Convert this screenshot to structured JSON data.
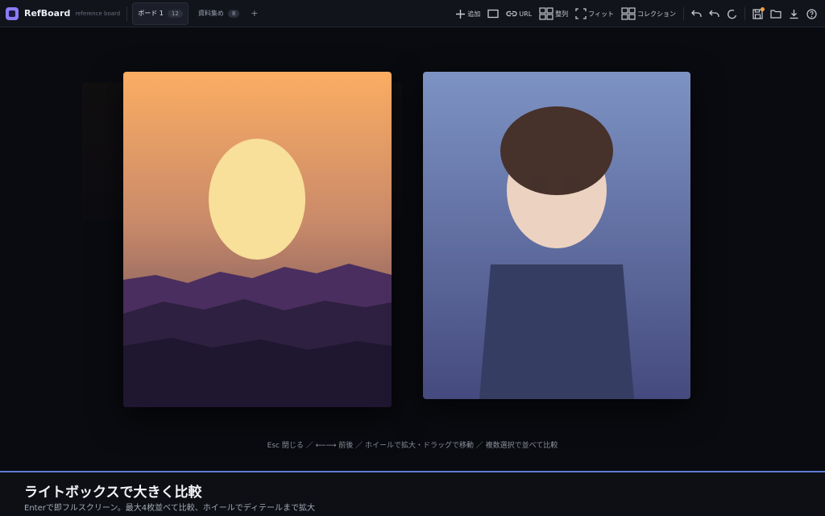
{
  "app": {
    "name": "RefBoard",
    "subtitle": "reference board"
  },
  "tabs": [
    {
      "label": "ボード 1",
      "count": "12",
      "active": true
    },
    {
      "label": "資料集め",
      "count": "8",
      "active": false
    }
  ],
  "tab_add": "+",
  "toolbar": {
    "add": "追加",
    "url": "URL",
    "arrange": "整列",
    "fit": "フィット",
    "collection": "コレクション"
  },
  "hint": "Esc 閉じる ／ ⟵⟶ 前後 ／ ホイールで拡大・ドラッグで移動 ／ 複数選択で並べて比較",
  "caption": {
    "title": "ライトボックスで大きく比較",
    "subtitle": "Enterで即フルスクリーン。最大4枚並べて比較、ホイールでディテールまで拡大"
  },
  "colors": {
    "accent": "#8b7cf6",
    "caption_border": "#5f7bd6",
    "notification": "#f2a33a"
  },
  "icons": [
    "add-icon",
    "frame-icon",
    "link-icon",
    "arrange-icon",
    "fit-icon",
    "collection-icon",
    "undo-icon",
    "undo2-icon",
    "redo-icon",
    "save-icon",
    "folder-icon",
    "download-icon",
    "help-icon"
  ]
}
